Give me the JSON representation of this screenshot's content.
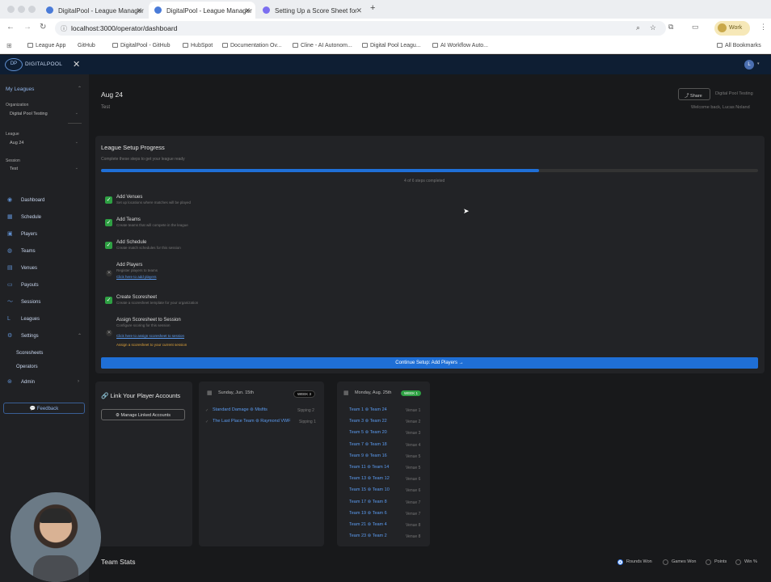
{
  "browser": {
    "tabs": [
      {
        "label": "DigitalPool - League Manager",
        "active": false
      },
      {
        "label": "DigitalPool - League Manager",
        "active": true
      },
      {
        "label": "Setting Up a Score Sheet for",
        "active": false
      }
    ],
    "new_tab": "+",
    "url": "localhost:3000/operator/dashboard",
    "profile": "Work",
    "bookmarks": [
      "League App",
      "GitHub",
      "DigitalPool - GitHub",
      "HubSpot",
      "Documentation Ov...",
      "Cline - AI Autonom...",
      "Digital Pool Leagu...",
      "AI Workflow Auto..."
    ],
    "all_bookmarks": "All Bookmarks"
  },
  "app": {
    "logo": "DIGITALPOOL",
    "avatar": "L"
  },
  "sidebar": {
    "my_leagues": "My Leagues",
    "org_label": "Organization",
    "org_value": "Digital Pool Testing",
    "league_label": "League",
    "league_value": "Aug 24",
    "session_label": "Session",
    "session_value": "Test",
    "nav": [
      {
        "label": "Dashboard",
        "icon": "grid-icon"
      },
      {
        "label": "Schedule",
        "icon": "calendar-icon"
      },
      {
        "label": "Players",
        "icon": "user-icon"
      },
      {
        "label": "Teams",
        "icon": "users-icon"
      },
      {
        "label": "Venues",
        "icon": "building-icon"
      },
      {
        "label": "Payouts",
        "icon": "money-icon"
      },
      {
        "label": "Sessions",
        "icon": "chart-icon"
      },
      {
        "label": "Leagues",
        "icon": "league-icon"
      },
      {
        "label": "Settings",
        "icon": "gear-icon"
      }
    ],
    "sub_nav": [
      "Scoresheets",
      "Operators"
    ],
    "admin": "Admin",
    "feedback": "Feedback"
  },
  "header": {
    "title": "Aug 24",
    "subtitle": "Test",
    "share": "Share",
    "org": "Digital Pool Testing",
    "welcome": "Welcome back, Lucas Noland"
  },
  "progress": {
    "title": "League Setup Progress",
    "subtitle": "Complete these steps to get your league ready",
    "fraction": 0.667,
    "status": "4 of 6 steps completed",
    "steps": [
      {
        "title": "Add Venues",
        "desc": "Set up locations where matches will be played",
        "done": true
      },
      {
        "title": "Add Teams",
        "desc": "Create teams that will compete in the league",
        "done": true
      },
      {
        "title": "Add Schedule",
        "desc": "Create match schedules for this session",
        "done": true
      },
      {
        "title": "Add Players",
        "desc": "Register players to teams",
        "done": false,
        "link": "Click here to add players"
      },
      {
        "title": "Create Scoresheet",
        "desc": "Create a scoresheet template for your organization",
        "done": true
      },
      {
        "title": "Assign Scoresheet to Session",
        "desc": "Configure scoring for this session",
        "done": false,
        "link": "Click here to assign scoresheet to session",
        "warning": "Assign a scoresheet to your current session"
      }
    ],
    "cta": "Continue Setup: Add Players →"
  },
  "link_accounts": {
    "title": "Link Your Player Accounts",
    "button": "Manage Linked Accounts"
  },
  "schedule1": {
    "date": "Sunday, Jun. 15th",
    "badge": "WEEK 3",
    "matches": [
      {
        "home": "Standard Damage",
        "away": "Misfits",
        "venue": "Sipping 2"
      },
      {
        "home": "The Last Place Team",
        "away": "Raymond VWF",
        "venue": "Sipping 1"
      }
    ]
  },
  "schedule2": {
    "date": "Monday, Aug. 25th",
    "badge": "WEEK 1",
    "matches": [
      {
        "home": "Team 1",
        "away": "Team 24",
        "venue": "Venue 1"
      },
      {
        "home": "Team 3",
        "away": "Team 22",
        "venue": "Venue 2"
      },
      {
        "home": "Team 5",
        "away": "Team 20",
        "venue": "Venue 3"
      },
      {
        "home": "Team 7",
        "away": "Team 18",
        "venue": "Venue 4"
      },
      {
        "home": "Team 9",
        "away": "Team 16",
        "venue": "Venue 5"
      },
      {
        "home": "Team 11",
        "away": "Team 14",
        "venue": "Venue 5"
      },
      {
        "home": "Team 13",
        "away": "Team 12",
        "venue": "Venue 6"
      },
      {
        "home": "Team 15",
        "away": "Team 10",
        "venue": "Venue 6"
      },
      {
        "home": "Team 17",
        "away": "Team 8",
        "venue": "Venue 7"
      },
      {
        "home": "Team 19",
        "away": "Team 6",
        "venue": "Venue 7"
      },
      {
        "home": "Team 21",
        "away": "Team 4",
        "venue": "Venue 8"
      },
      {
        "home": "Team 23",
        "away": "Team 2",
        "venue": "Venue 8"
      }
    ]
  },
  "team_stats": {
    "title": "Team Stats",
    "options": [
      "Rounds Won",
      "Games Won",
      "Points",
      "Win %"
    ],
    "selected": "Rounds Won"
  },
  "colors": {
    "accent": "#1f6fd6",
    "success": "#2ea043",
    "warning": "#e0a33a"
  }
}
